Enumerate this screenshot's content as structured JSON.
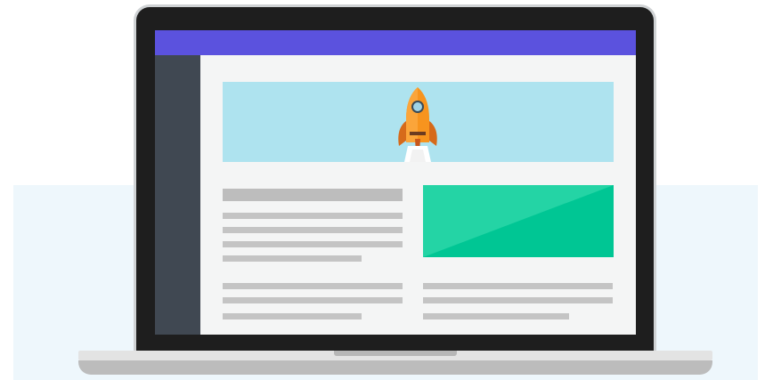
{
  "colors": {
    "backdrop": "#eef7fc",
    "bezel": "#1e1e1e",
    "bezel_rim": "#cfd2d4",
    "topbar": "#5b52de",
    "sidebar": "#404852",
    "content_bg": "#f4f5f5",
    "hero_bg": "#aee3ef",
    "green_light": "#24d4a5",
    "green_dark": "#00c694",
    "placeholder_gray": "#c4c4c4",
    "base_top": "#e3e3e3",
    "base_bottom": "#bcbcbc",
    "base_notch": "#b6b6b6"
  },
  "illustration": {
    "subject": "laptop-icon",
    "hero_icon": "rocket-icon"
  }
}
